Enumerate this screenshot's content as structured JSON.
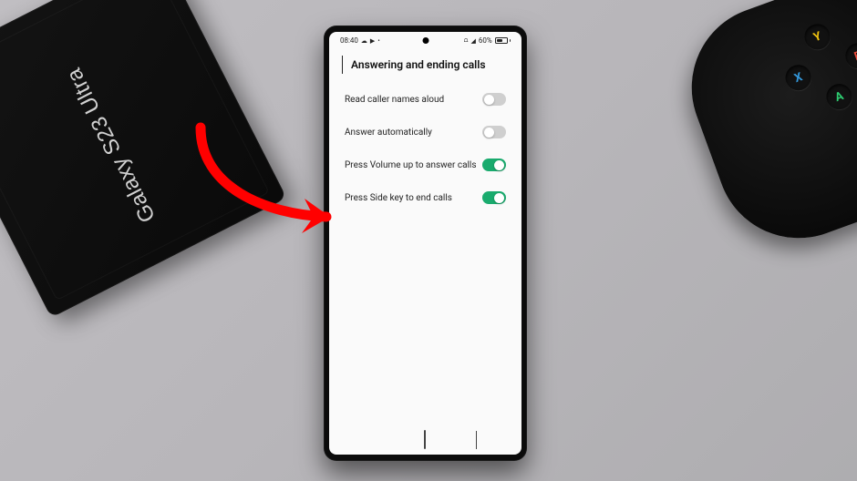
{
  "box_label": "Galaxy S23 Ultra",
  "status": {
    "time": "08:40",
    "battery_text": "60%"
  },
  "header": {
    "title": "Answering and ending calls"
  },
  "settings": [
    {
      "label": "Read caller names aloud",
      "state": "off"
    },
    {
      "label": "Answer automatically",
      "state": "off"
    },
    {
      "label": "Press Volume up to answer calls",
      "state": "on"
    },
    {
      "label": "Press Side key to end calls",
      "state": "on"
    }
  ]
}
